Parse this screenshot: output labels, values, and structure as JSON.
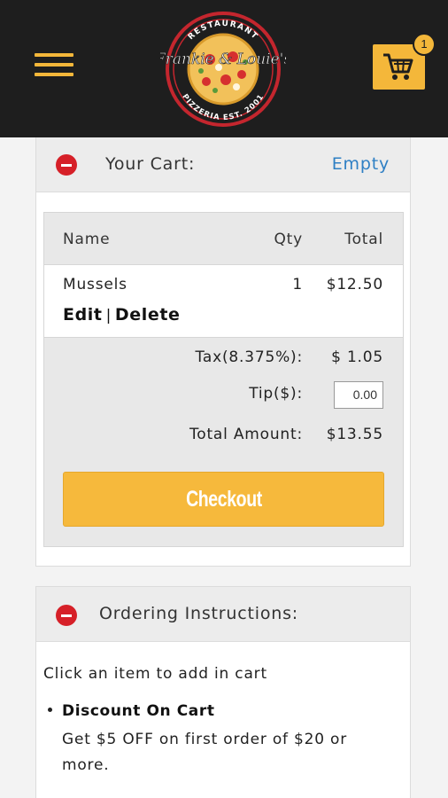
{
  "header": {
    "logo": {
      "top_text": "RESTAURANT",
      "script_text": "Frankie & Louie's",
      "bottom_text": "PIZZERIA EST. 2001"
    },
    "cart_count": "1",
    "colors": {
      "bar": "#1e1e1e",
      "accent": "#f4b73a"
    }
  },
  "cart": {
    "title": "Your Cart:",
    "empty_label": "Empty",
    "columns": {
      "name": "Name",
      "qty": "Qty",
      "total": "Total"
    },
    "items": [
      {
        "name": "Mussels",
        "qty": "1",
        "total": "$12.50",
        "edit": "Edit",
        "separator": "|",
        "delete": "Delete"
      }
    ],
    "tax_label": "Tax(8.375%):",
    "tax_value": "$ 1.05",
    "tip_label": "Tip($):",
    "tip_value": "0.00",
    "total_label": "Total Amount:",
    "total_value": "$13.55",
    "checkout_label": "Checkout"
  },
  "instructions": {
    "title": "Ordering Instructions:",
    "intro": "Click an item to add in cart",
    "discount_title": "Discount On Cart",
    "discount_body": "Get $5 OFF on first order of $20 or more."
  }
}
